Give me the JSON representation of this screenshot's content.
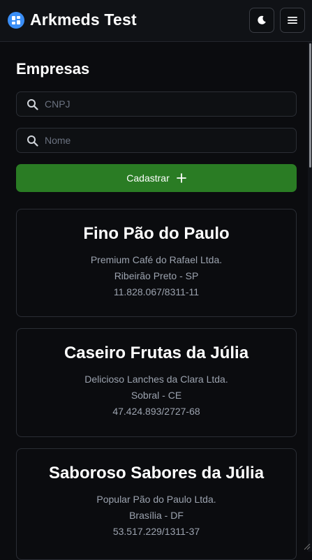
{
  "header": {
    "title": "Arkmeds Test",
    "logo_icon": "grid-icon",
    "theme_icon": "moon-icon",
    "menu_icon": "hamburger-menu-icon"
  },
  "page": {
    "title": "Empresas"
  },
  "search": {
    "cnpj_placeholder": "CNPJ",
    "cnpj_value": "",
    "nome_placeholder": "Nome",
    "nome_value": ""
  },
  "actions": {
    "add_label": "Cadastrar",
    "add_icon": "plus-icon"
  },
  "companies": [
    {
      "name": "Fino Pão do Paulo",
      "legal_name": "Premium Café do Rafael Ltda.",
      "location": "Ribeirão Preto - SP",
      "cnpj": "11.828.067/8311-11"
    },
    {
      "name": "Caseiro Frutas da Júlia",
      "legal_name": "Delicioso Lanches da Clara Ltda.",
      "location": "Sobral - CE",
      "cnpj": "47.424.893/2727-68"
    },
    {
      "name": "Saboroso Sabores da Júlia",
      "legal_name": "Popular Pão do Paulo Ltda.",
      "location": "Brasília - DF",
      "cnpj": "53.517.229/1311-37"
    }
  ],
  "colors": {
    "background": "#0b0c0f",
    "accent_green": "#2a7c24",
    "logo_blue": "#3a8ef6",
    "muted_text": "#9ca3af"
  }
}
